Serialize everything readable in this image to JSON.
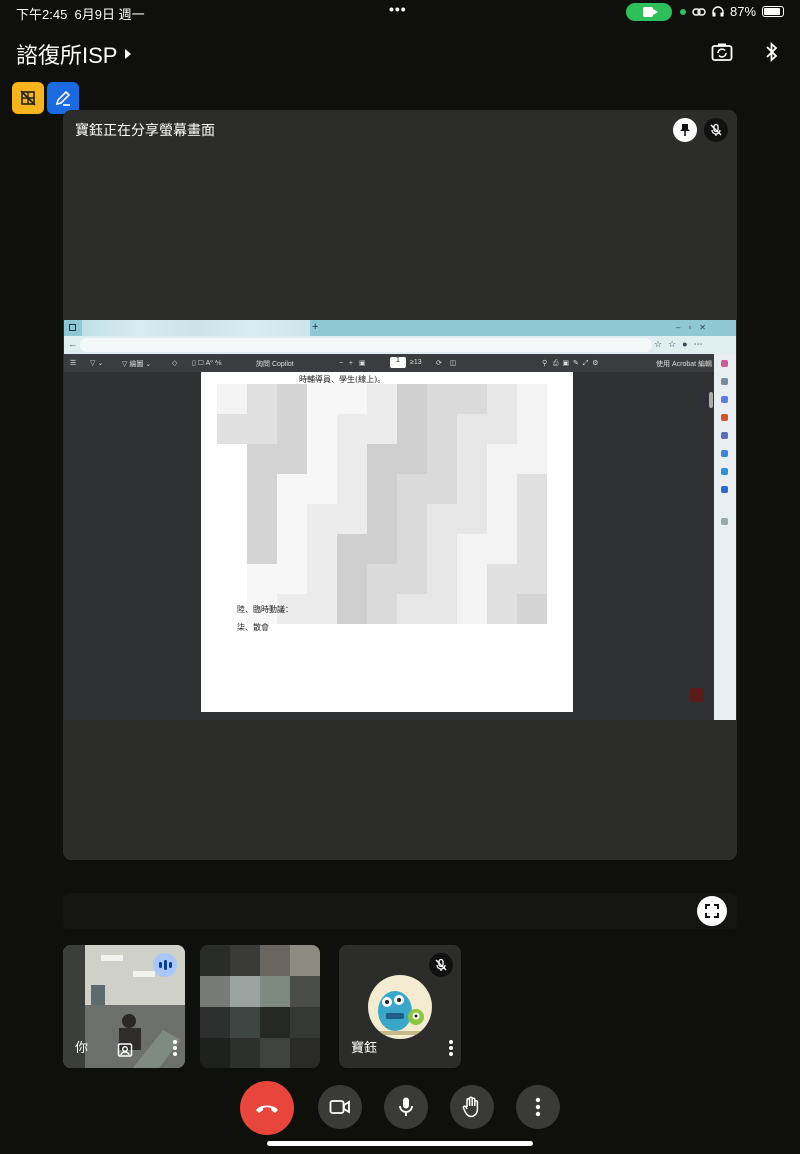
{
  "status_bar": {
    "time": "下午2:45",
    "date": "6月9日 週一",
    "battery": "87%",
    "dots": "•••"
  },
  "header": {
    "meeting_title": "諮復所ISP",
    "switch_camera_icon": "camera-switch-icon",
    "bluetooth_icon": "bluetooth-icon"
  },
  "stage": {
    "presenting_label": "寶鈺正在分享螢幕畫面",
    "shared_doc": {
      "toolbar_draw": "繪圖",
      "toolbar_copilot": "詢問 Copilot",
      "toolbar_page": "1",
      "toolbar_page_total": "13",
      "toolbar_acrobat": "使用 Acrobat 編輯",
      "line_top": "時輔導員、學生(線上)。",
      "line_6": "陸、臨時動議：",
      "line_7": "柒、散會",
      "tab_plus": "+"
    }
  },
  "tiles": {
    "self_name": "你",
    "participant_name": "寶鈺"
  },
  "colors": {
    "end_call": "#e8453c",
    "badge_yellow": "#f6b51e",
    "badge_blue": "#1a6be0",
    "cam_pill": "#2fbf5a"
  }
}
